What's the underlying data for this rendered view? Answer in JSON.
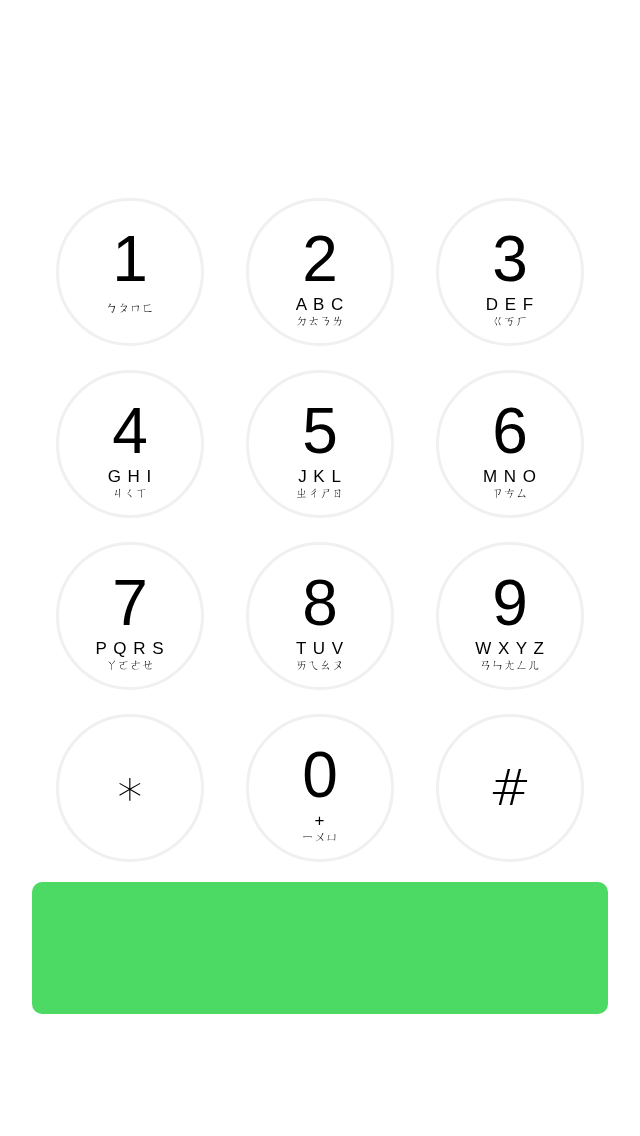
{
  "keypad": [
    {
      "kind": "digit",
      "digit": "1",
      "bopomofo": "ㄅㄆㄇㄈ"
    },
    {
      "kind": "digit",
      "digit": "2",
      "letters": "A B C",
      "bopomofo": "ㄉㄊㄋㄌ"
    },
    {
      "kind": "digit",
      "digit": "3",
      "letters": "D E F",
      "bopomofo": "ㄍㄎㄏ"
    },
    {
      "kind": "digit",
      "digit": "4",
      "letters": "G H I",
      "bopomofo": "ㄐㄑㄒ"
    },
    {
      "kind": "digit",
      "digit": "5",
      "letters": "J K L",
      "bopomofo": "ㄓㄔㄕㄖ"
    },
    {
      "kind": "digit",
      "digit": "6",
      "letters": "M N O",
      "bopomofo": "ㄗㄘㄙ"
    },
    {
      "kind": "digit",
      "digit": "7",
      "letters": "P Q R S",
      "bopomofo": "ㄚㄛㄜㄝ"
    },
    {
      "kind": "digit",
      "digit": "8",
      "letters": "T U V",
      "bopomofo": "ㄞㄟㄠㄡ"
    },
    {
      "kind": "digit",
      "digit": "9",
      "letters": "W X Y Z",
      "bopomofo": "ㄢㄣㄤㄥㄦ"
    },
    {
      "kind": "symbol",
      "digit": "∗"
    },
    {
      "kind": "digit",
      "digit": "0",
      "letters": "+",
      "bopomofo": "ㄧㄨㄩ"
    },
    {
      "kind": "symbol",
      "digit": "#"
    }
  ],
  "call_button": {
    "kind": "call"
  }
}
